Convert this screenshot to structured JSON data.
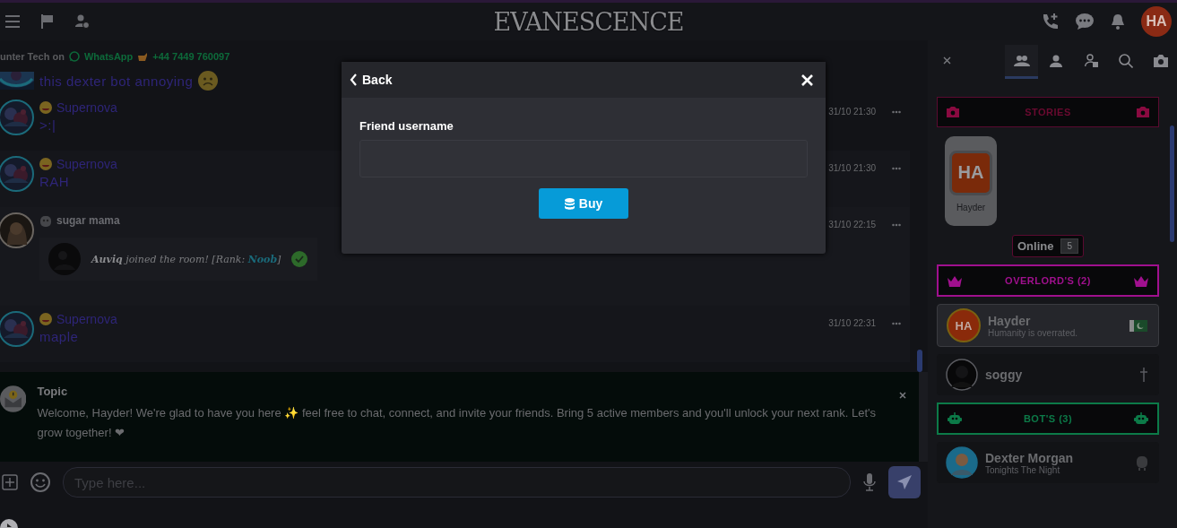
{
  "top_bar": {
    "logo": "EVANESCENCE",
    "avatar": "HA"
  },
  "chat": {
    "notice": {
      "prefix": "unter Tech on",
      "app": "WhatsApp",
      "phone": "+44 7449 760097"
    },
    "messages": [
      {
        "kind": "cut",
        "text": "this dexter bot annoying"
      },
      {
        "kind": "text",
        "name": "Supernova",
        "text": ">:|",
        "time": "31/10 21:30"
      },
      {
        "kind": "text",
        "name": "Supernova",
        "text": "RAH",
        "time": "31/10 21:30"
      },
      {
        "kind": "system",
        "name": "sugar mama",
        "time": "31/10 22:15",
        "user": "Auviq",
        "action": " joined the room! [Rank: ",
        "rank": "Noob",
        "end": "]"
      },
      {
        "kind": "text",
        "name": "Supernova",
        "text": "maple",
        "time": "31/10 22:31"
      }
    ],
    "topic": {
      "title": "Topic",
      "text": "Welcome, Hayder! We're glad to have you here ✨ feel free to chat, connect, and invite your friends. Bring 5 active members and you'll unlock your next rank. Let's grow together! ❤"
    },
    "input": {
      "placeholder": "Type here..."
    }
  },
  "panel": {
    "tabs": [
      {
        "kind": "close",
        "selected": false
      },
      {
        "kind": "group",
        "selected": true
      },
      {
        "kind": "user",
        "selected": false
      },
      {
        "kind": "lock",
        "selected": false
      },
      {
        "kind": "search",
        "selected": false
      },
      {
        "kind": "camera",
        "selected": false
      }
    ],
    "stories": {
      "title": "STORIES",
      "items": [
        {
          "initials": "HA",
          "name": "Hayder"
        }
      ]
    },
    "online": {
      "label": "Online",
      "count": "5"
    },
    "groups": [
      {
        "kind": "crown",
        "title": "OVERLORD'S (2)",
        "color": "#a0108e",
        "users": [
          {
            "name": "Hayder",
            "initials": "HA",
            "status": "Humanity is overrated.",
            "selected": true
          },
          {
            "name": "soggy",
            "selected": false
          }
        ]
      },
      {
        "kind": "robot",
        "title": "BOT'S (3)",
        "color": "#0c7a48",
        "users": [
          {
            "name": "Dexter Morgan",
            "status": "Tonights The Night",
            "selected": false
          }
        ]
      }
    ]
  },
  "modal": {
    "back": "Back",
    "label": "Friend username",
    "button": "Buy"
  }
}
